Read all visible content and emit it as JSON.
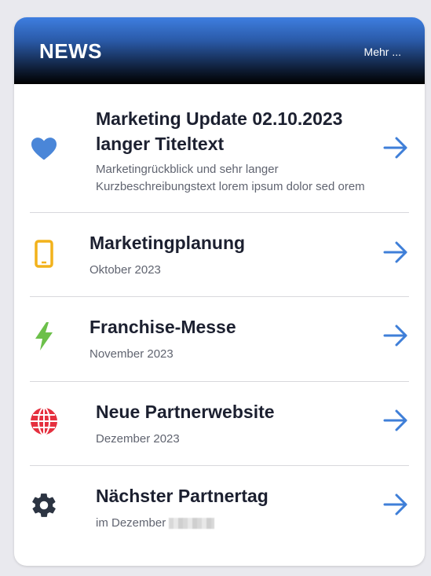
{
  "header": {
    "title": "NEWS",
    "more_label": "Mehr ..."
  },
  "items": [
    {
      "icon": "heart-icon",
      "title_line1": "Marketing Update 02.10.2023",
      "title_line2": "langer Titeltext",
      "sub_line1": "Marketingrückblick und sehr langer",
      "sub_line2": "Kurzbeschreibungstext lorem ipsum dolor sed orem"
    },
    {
      "icon": "phone-icon",
      "title": "Marketingplanung",
      "sub": "Oktober 2023"
    },
    {
      "icon": "lightning-icon",
      "title": "Franchise-Messe",
      "sub": "November 2023"
    },
    {
      "icon": "globe-icon",
      "title": "Neue Partnerwebsite",
      "sub": "Dezember 2023"
    },
    {
      "icon": "gear-icon",
      "title": "Nächster Partnertag",
      "sub": "im Dezember"
    }
  ],
  "colors": {
    "heart": "#4a86d8",
    "phone": "#f2b21b",
    "lightning": "#6cc04a",
    "globe": "#e5303f",
    "gear": "#2c3442",
    "arrow": "#3f7fd8"
  }
}
